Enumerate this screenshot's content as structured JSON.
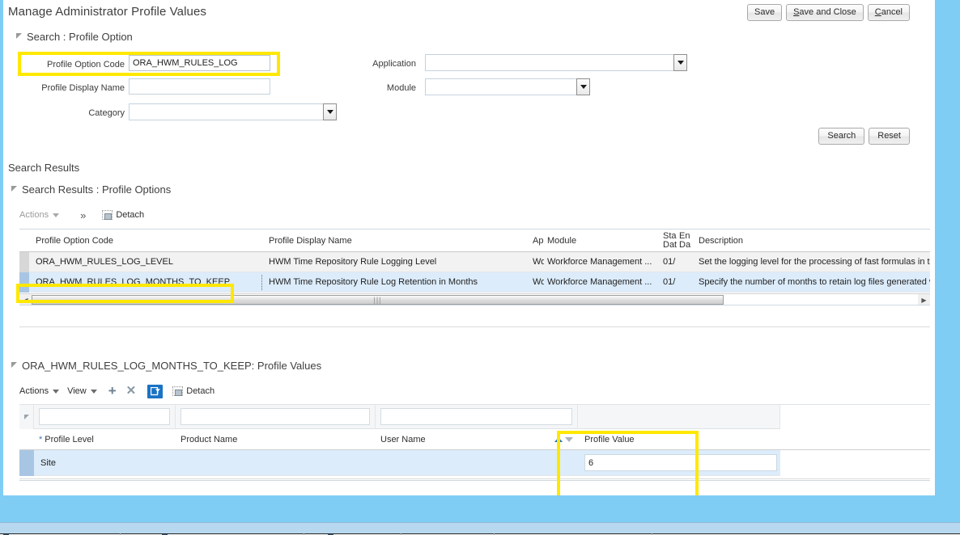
{
  "window": {
    "title": "Manage Administrator Profile Values"
  },
  "toolbar": {
    "save": "Save",
    "save_and_close_pre": "S",
    "save_and_close_post": "ave and Close",
    "cancel_pre": "C",
    "cancel_post": "ancel"
  },
  "search_section": {
    "header": "Search : Profile Option",
    "fields": {
      "profile_option_code_label": "Profile Option Code",
      "profile_option_code_value": "ORA_HWM_RULES_LOG",
      "profile_display_name_label": "Profile Display Name",
      "profile_display_name_value": "",
      "category_label": "Category",
      "category_value": "",
      "application_label": "Application",
      "application_value": "",
      "module_label": "Module",
      "module_value": ""
    },
    "buttons": {
      "search": "Search",
      "reset": "Reset"
    }
  },
  "results_section": {
    "caption": "Search Results",
    "header": "Search Results : Profile Options",
    "toolbar": {
      "actions": "Actions",
      "chevrons": "»",
      "detach": "Detach"
    },
    "columns": [
      "Profile Option Code",
      "Profile Display Name",
      "App",
      "Module",
      "Sta\nDat",
      "En\nDa",
      "Description"
    ],
    "column_headers_display": {
      "code": "Profile Option Code",
      "display_name": "Profile Display Name",
      "app": "App",
      "module": "Module",
      "start_date_l1": "Sta",
      "start_date_l2": "Dat",
      "end_date_l1": "En",
      "end_date_l2": "Da",
      "description": "Description"
    },
    "rows": [
      {
        "code": "ORA_HWM_RULES_LOG_LEVEL",
        "display_name": "HWM Time Repository Rule Logging Level",
        "app": "Wo",
        "module": "Workforce Management ...",
        "start_date": "01/",
        "end_date": "",
        "description": "Set the logging level for the processing of fast formulas in tim",
        "selected": false
      },
      {
        "code": "ORA_HWM_RULES_LOG_MONTHS_TO_KEEP",
        "display_name": "HWM Time Repository Rule Log Retention in Months",
        "app": "Wo",
        "module": "Workforce Management ...",
        "start_date": "01/",
        "end_date": "",
        "description": "Specify the number of months to retain log files generated w",
        "selected": true
      }
    ]
  },
  "values_section": {
    "header": "ORA_HWM_RULES_LOG_MONTHS_TO_KEEP: Profile Values",
    "toolbar": {
      "actions": "Actions",
      "view": "View",
      "add": "+",
      "remove": "✕",
      "query_by_example": "query-filter",
      "detach": "Detach"
    },
    "columns": {
      "profile_level": "Profile Level",
      "product_name": "Product Name",
      "user_name": "User Name",
      "profile_value": "Profile Value"
    },
    "filter_row": {
      "profile_level": "",
      "product_name": "",
      "user_name": ""
    },
    "rows": [
      {
        "profile_level": "Site",
        "product_name": "",
        "user_name": "",
        "profile_value": "6"
      }
    ]
  },
  "highlights": {
    "color": "#FFE800",
    "regions": [
      "profile-option-code-field",
      "result-row-months-to-keep-code",
      "profile-value-column"
    ]
  }
}
